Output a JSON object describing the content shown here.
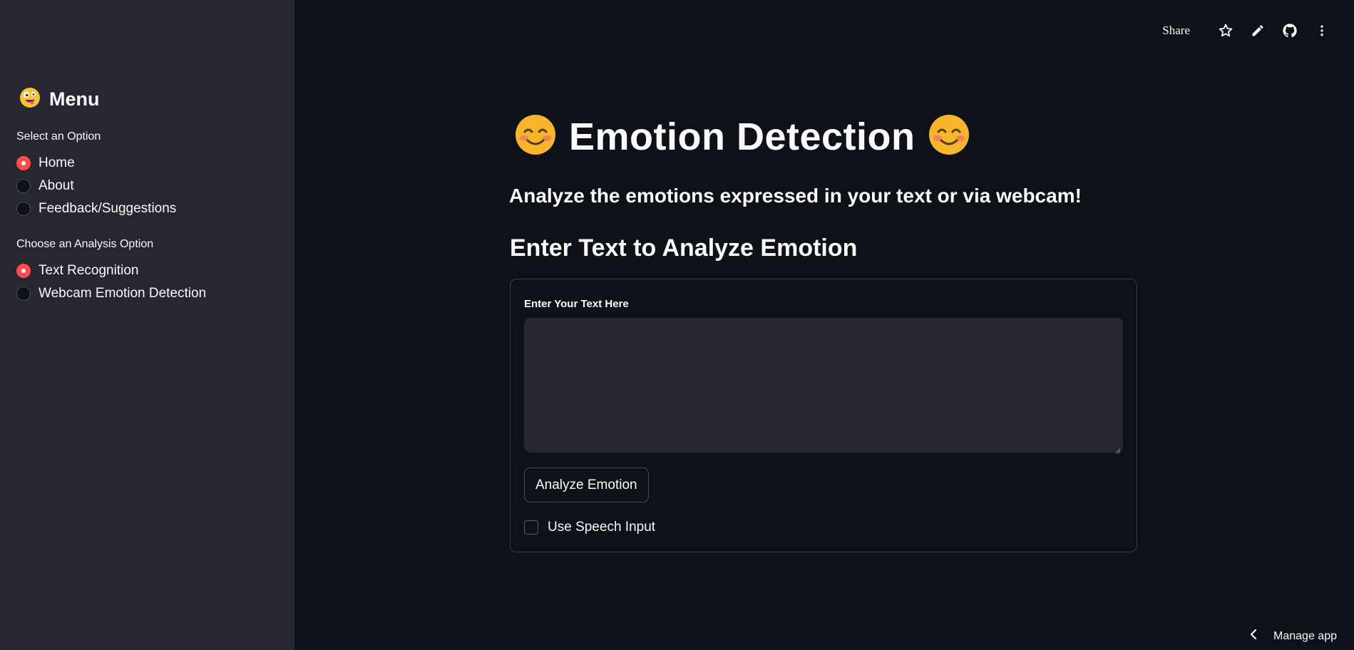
{
  "sidebar": {
    "title": "Menu",
    "title_icon": "zany-face-icon",
    "select_label": "Select an Option",
    "select_options": [
      {
        "label": "Home",
        "selected": true
      },
      {
        "label": "About",
        "selected": false
      },
      {
        "label": "Feedback/Suggestions",
        "selected": false
      }
    ],
    "analysis_label": "Choose an Analysis Option",
    "analysis_options": [
      {
        "label": "Text Recognition",
        "selected": true
      },
      {
        "label": "Webcam Emotion Detection",
        "selected": false
      }
    ]
  },
  "toolbar": {
    "share_label": "Share",
    "icons": [
      "star-icon",
      "pencil-icon",
      "github-icon",
      "more-vertical-icon"
    ]
  },
  "main": {
    "title": "Emotion Detection",
    "title_icon": "smiling-face-icon",
    "subtitle": "Analyze the emotions expressed in your text or via webcam!",
    "section_heading": "Enter Text to Analyze Emotion",
    "form": {
      "field_label": "Enter Your Text Here",
      "text_value": "",
      "button_label": "Analyze Emotion",
      "checkbox_label": "Use Speech Input",
      "checkbox_checked": false
    }
  },
  "footer": {
    "manage_app_label": "Manage app"
  },
  "colors": {
    "accent": "#ff4b4b",
    "background": "#0e1117",
    "sidebar_background": "#262730",
    "text": "#fafafa"
  }
}
